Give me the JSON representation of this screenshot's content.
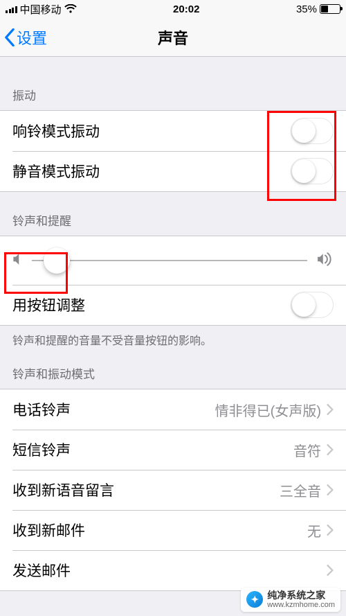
{
  "status": {
    "carrier": "中国移动",
    "time": "20:02",
    "battery_pct": "35%"
  },
  "nav": {
    "back_label": "设置",
    "title": "声音"
  },
  "sections": {
    "vibration_header": "振动",
    "ring_vibrate_label": "响铃模式振动",
    "silent_vibrate_label": "静音模式振动",
    "ringer_header": "铃声和提醒",
    "change_with_buttons_label": "用按钮调整",
    "ringer_footer": "铃声和提醒的音量不受音量按钮的影响。",
    "patterns_header": "铃声和振动模式",
    "ringtone_label": "电话铃声",
    "ringtone_value": "情非得已(女声版)",
    "texttone_label": "短信铃声",
    "texttone_value": "音符",
    "voicemail_label": "收到新语音留言",
    "voicemail_value": "三全音",
    "newmail_label": "收到新邮件",
    "newmail_value": "无",
    "sentmail_label": "发送邮件"
  },
  "watermark": {
    "title": "纯净系统之家",
    "url": "www.kzmhome.com"
  }
}
